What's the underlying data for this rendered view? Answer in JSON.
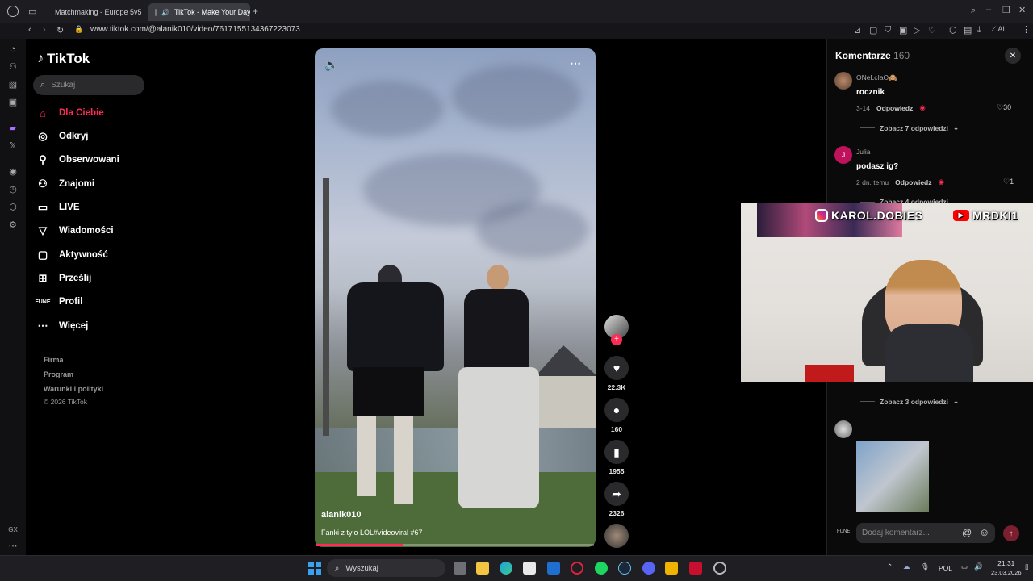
{
  "browser": {
    "tabs": [
      {
        "label": "Matchmaking - Europe 5v5",
        "active": false
      },
      {
        "label": "TikTok - Make Your Day",
        "active": true
      }
    ],
    "url_host": "www.tiktok.com",
    "url_path": "/@alanik010/video/7617155134367223073",
    "ai_label": "AI"
  },
  "sidebar": {
    "logo": "TikTok",
    "search_placeholder": "Szukaj",
    "items": [
      {
        "label": "Dla Ciebie",
        "icon": "home-icon",
        "active": true
      },
      {
        "label": "Odkryj",
        "icon": "compass-icon",
        "active": false
      },
      {
        "label": "Obserwowani",
        "icon": "following-icon",
        "active": false
      },
      {
        "label": "Znajomi",
        "icon": "friends-icon",
        "active": false
      },
      {
        "label": "LIVE",
        "icon": "live-icon",
        "active": false
      },
      {
        "label": "Wiadomości",
        "icon": "messages-icon",
        "active": false
      },
      {
        "label": "Aktywność",
        "icon": "activity-icon",
        "active": false
      },
      {
        "label": "Prześlij",
        "icon": "upload-icon",
        "active": false
      },
      {
        "label": "Profil",
        "icon": "profile-icon",
        "active": false
      },
      {
        "label": "Więcej",
        "icon": "more-icon",
        "active": false
      }
    ],
    "footer": [
      "Firma",
      "Program",
      "Warunki i polityki",
      "© 2026 TikTok"
    ]
  },
  "video": {
    "author": "alanik010",
    "caption": "Fanki z tylo LOL#videoviral #67",
    "progress": 0.31
  },
  "actions": {
    "likes": "22.3K",
    "comments": "160",
    "saves": "1955",
    "shares": "2326"
  },
  "comments_panel": {
    "title": "Komentarze",
    "count": "160",
    "comments": [
      {
        "name": "ONeLcIaO🙈",
        "text": "rocznik",
        "date": "3-14",
        "reply": "Odpowiedz",
        "likes": "30",
        "more": "Zobacz 7 odpowiedzi"
      },
      {
        "name": "Julia",
        "text": "podasz ig?",
        "date": "2 dn. temu",
        "reply": "Odpowiedz",
        "likes": "1",
        "more": "Zobacz 4 odpowiedzi"
      }
    ],
    "hidden_more": "Zobacz 3 odpowiedzi",
    "input_placeholder": "Dodaj komentarz...",
    "avatar_initial": "J"
  },
  "webcam": {
    "instagram": "KAROL.DOBIES",
    "youtube": "MRDKI1"
  },
  "taskbar": {
    "search_label": "Wyszukaj",
    "lang": "POL",
    "time": "21:31",
    "date": "23.03.2026"
  },
  "gx": {
    "label": "GX"
  },
  "colors": {
    "accent": "#fe2c55",
    "background": "#000000"
  }
}
